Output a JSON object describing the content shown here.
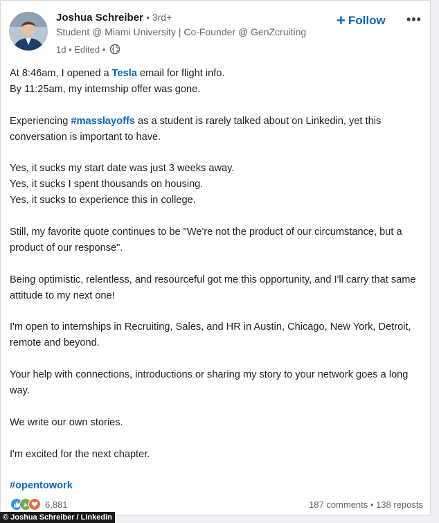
{
  "author": {
    "name": "Joshua Schreiber",
    "degree": "• 3rd+",
    "headline": "Student @ Miami University | Co-Founder @ GenZcruiting",
    "time": "1d • Edited •",
    "globe_icon": "globe-icon"
  },
  "actions": {
    "follow_plus": "+",
    "follow_label": "Follow",
    "more_label": "•••"
  },
  "post": {
    "p1a_pre": "At 8:46am, I opened a ",
    "p1a_link": "Tesla",
    "p1a_post": " email for flight info.",
    "p1b": "By 11:25am, my internship offer was gone.",
    "p2_pre": "Experiencing ",
    "p2_tag": "#masslayoffs",
    "p2_post": " as a student is rarely talked about on Linkedin, yet this conversation is important to have.",
    "p3a": "Yes, it sucks my start date was just 3 weeks away.",
    "p3b": "Yes, it sucks I spent thousands on housing.",
    "p3c": "Yes, it sucks to experience this in college.",
    "p4": "Still, my favorite quote continues to be \"We're not the product of our circumstance, but a product of our response\".",
    "p5": "Being optimistic, relentless, and resourceful got me this opportunity, and I'll carry that same attitude to my next one!",
    "p6": "I'm open to internships in Recruiting, Sales, and HR in Austin, Chicago, New York, Detroit, remote and beyond.",
    "p7": "Your help with connections, introductions or sharing my story to your network goes a long way.",
    "p8": "We write our own stories.",
    "p9": "I'm excited for the next chapter.",
    "p10_tag": "#opentowork"
  },
  "social": {
    "reaction_count": "6,881",
    "comments": "187 comments",
    "separator": " • ",
    "reposts": "138 reposts"
  },
  "credit": "© Joshua Schreiber / Linkedin",
  "colors": {
    "accent": "#0a66c2",
    "like": "#378fe9",
    "celebrate": "#6dae4f",
    "love": "#df704d"
  }
}
